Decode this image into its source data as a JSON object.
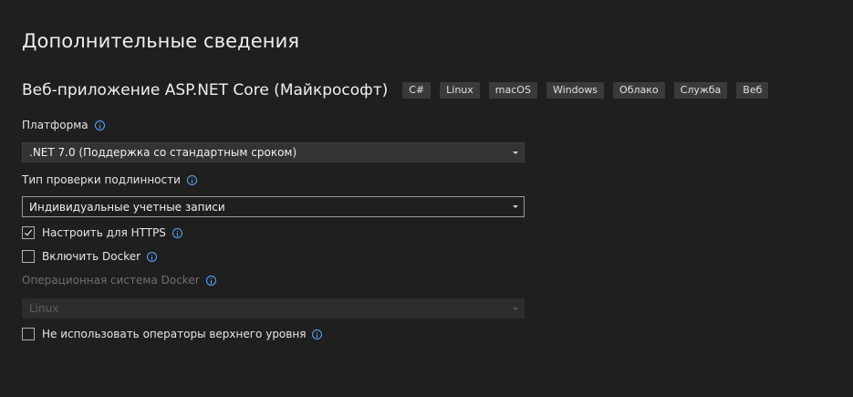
{
  "page": {
    "title": "Дополнительные сведения"
  },
  "template": {
    "name": "Веб-приложение ASP.NET Core (Майкрософт)",
    "tags": [
      "C#",
      "Linux",
      "macOS",
      "Windows",
      "Облако",
      "Служба",
      "Веб"
    ]
  },
  "framework": {
    "label": "Платформа",
    "value": ".NET 7.0 (Поддержка со стандартным сроком)"
  },
  "auth": {
    "label": "Тип проверки подлинности",
    "value": "Индивидуальные учетные записи"
  },
  "https": {
    "label": "Настроить для HTTPS",
    "checked": true
  },
  "docker": {
    "label": "Включить Docker",
    "checked": false
  },
  "docker_os": {
    "label": "Операционная система Docker",
    "value": "Linux",
    "enabled": false
  },
  "top_level": {
    "label": "Не использовать операторы верхнего уровня",
    "checked": false
  },
  "colors": {
    "background": "#1f1f1f",
    "info_icon": "#58a6ff",
    "tag_background": "#3a3a3a"
  }
}
